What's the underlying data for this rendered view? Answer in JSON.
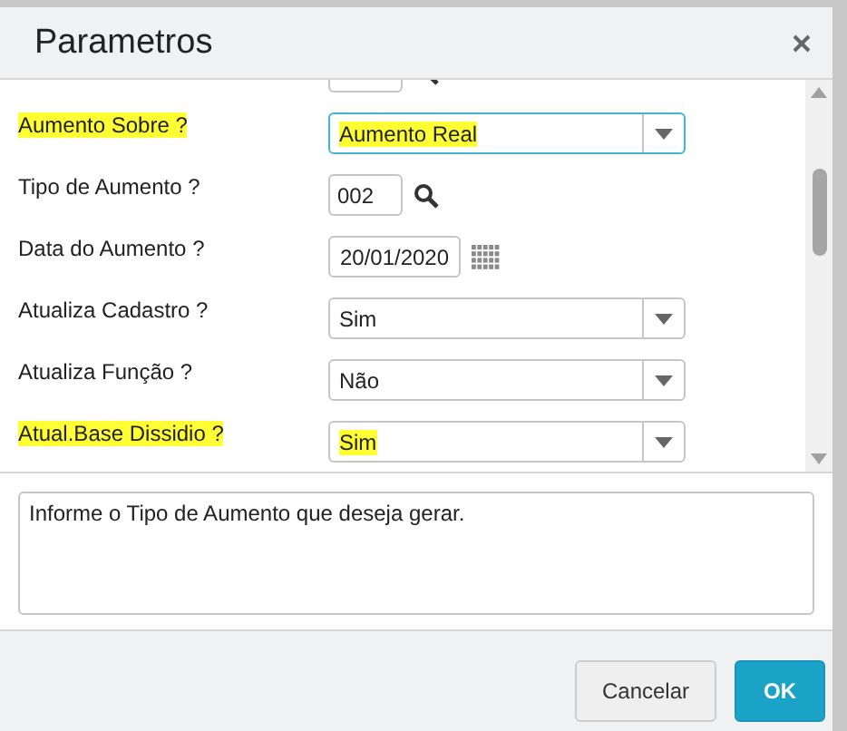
{
  "window": {
    "title": "Parametros"
  },
  "fields": [
    {
      "kind": "lookup",
      "focused": false
    },
    {
      "kind": "select",
      "label": "Aumento Sobre ?",
      "value": "Aumento Real",
      "highlighted": true,
      "focused": true
    },
    {
      "kind": "lookup",
      "label": "Tipo de Aumento ?",
      "value": "002",
      "highlighted": false,
      "focused": false
    },
    {
      "kind": "date",
      "label": "Data do Aumento ?",
      "value": "20/01/2020",
      "highlighted": false,
      "focused": false
    },
    {
      "kind": "select",
      "label": "Atualiza Cadastro ?",
      "value": "Sim",
      "highlighted": false,
      "focused": false
    },
    {
      "kind": "select",
      "label": "Atualiza Função ?",
      "value": "Não",
      "highlighted": false,
      "focused": false
    },
    {
      "kind": "select",
      "label": "Atual.Base Dissidio ?",
      "value": "Sim",
      "highlighted": true,
      "focused": false
    }
  ],
  "help_text": "Informe o Tipo de Aumento que deseja gerar.",
  "buttons": [
    {
      "label": "Cancelar",
      "kind": "secondary"
    },
    {
      "label": "OK",
      "kind": "primary"
    }
  ]
}
